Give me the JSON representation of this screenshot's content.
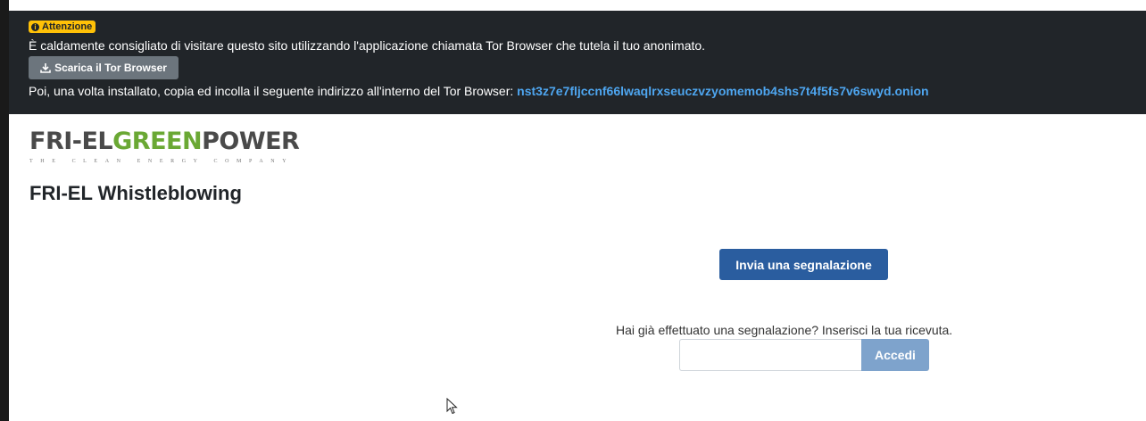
{
  "banner": {
    "badge": "Attenzione",
    "warning": "È caldamente consigliato di visitare questo sito utilizzando l'applicazione chiamata Tor Browser che tutela il tuo anonimato.",
    "download_label": "Scarica il Tor Browser",
    "instruction": "Poi, una volta installato, copia ed incolla il seguente indirizzo all'interno del Tor Browser:",
    "onion_address": "nst3z7e7fljccnf66lwaqlrxseuczvzyomemob4shs7t4f5fs7v6swyd.onion"
  },
  "logo": {
    "part1": "FRI-EL",
    "part2": "GREEN",
    "part3": "POWER",
    "tagline": "THE CLEAN ENERGY COMPANY"
  },
  "page": {
    "title": "FRI-EL Whistleblowing"
  },
  "actions": {
    "submit_label": "Invia una segnalazione",
    "receipt_prompt": "Hai già effettuato una segnalazione? Inserisci la tua ricevuta.",
    "receipt_value": "",
    "login_label": "Accedi"
  },
  "colors": {
    "banner_bg": "#212529",
    "badge": "#ffc107",
    "link": "#4ea6f0",
    "primary": "#2a5d9f",
    "brand_green": "#6aa834"
  },
  "icons": [
    "info-icon",
    "download-icon",
    "mouse-cursor-icon"
  ]
}
